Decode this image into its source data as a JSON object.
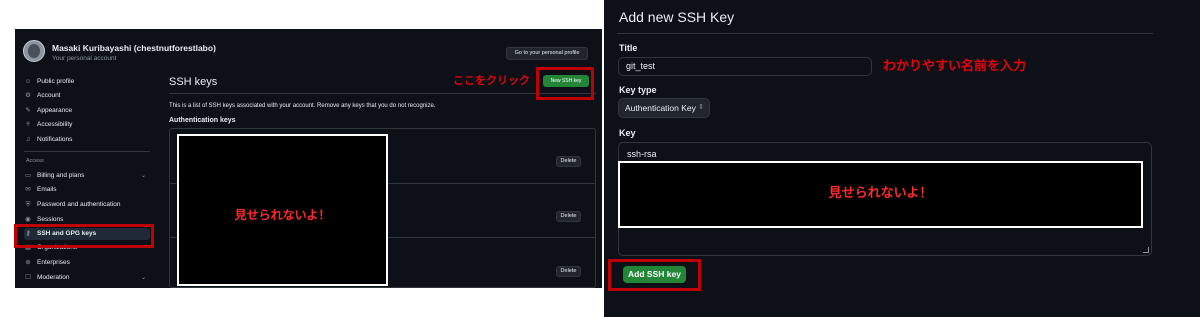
{
  "left": {
    "user": {
      "name": "Masaki Kuribayashi (chestnutforestlabo)",
      "subtitle": "Your personal account"
    },
    "go_profile_label": "Go to your personal profile",
    "sidebar": {
      "items_top": [
        {
          "label": "Public profile",
          "icon": "person-icon"
        },
        {
          "label": "Account",
          "icon": "gear-icon"
        },
        {
          "label": "Appearance",
          "icon": "paintbrush-icon"
        },
        {
          "label": "Accessibility",
          "icon": "accessibility-icon"
        },
        {
          "label": "Notifications",
          "icon": "bell-icon"
        }
      ],
      "section_access": "Access",
      "items_access": [
        {
          "label": "Billing and plans",
          "icon": "credit-card-icon"
        },
        {
          "label": "Emails",
          "icon": "mail-icon"
        },
        {
          "label": "Password and authentication",
          "icon": "shield-icon"
        },
        {
          "label": "Sessions",
          "icon": "broadcast-icon"
        },
        {
          "label": "SSH and GPG keys",
          "icon": "key-icon"
        },
        {
          "label": "Organizations",
          "icon": "organization-icon"
        },
        {
          "label": "Enterprises",
          "icon": "globe-icon"
        },
        {
          "label": "Moderation",
          "icon": "report-icon"
        }
      ]
    },
    "main": {
      "title": "SSH keys",
      "new_key_label": "New SSH key",
      "description": "This is a list of SSH keys associated with your account. Remove any keys that you do not recognize.",
      "subheading": "Authentication keys",
      "delete_label": "Delete"
    },
    "redaction_text": "見せられないよ！",
    "annotation_click": "ここをクリック"
  },
  "right": {
    "title": "Add new SSH Key",
    "title_label": "Title",
    "title_value": "git_test",
    "key_type_label": "Key type",
    "key_type_value": "Authentication Key",
    "key_label": "Key",
    "key_value": "ssh-rsa",
    "redaction_text": "見せられないよ！",
    "annotation_name": "わかりやすい名前を入力",
    "add_button_label": "Add SSH key"
  },
  "colors": {
    "panel_bg": "#0d1117",
    "border": "#30363d",
    "text": "#e6edf3",
    "muted": "#8b949e",
    "green": "#238636",
    "annotation_red": "#e60012",
    "highlight_box": "#c00000"
  }
}
